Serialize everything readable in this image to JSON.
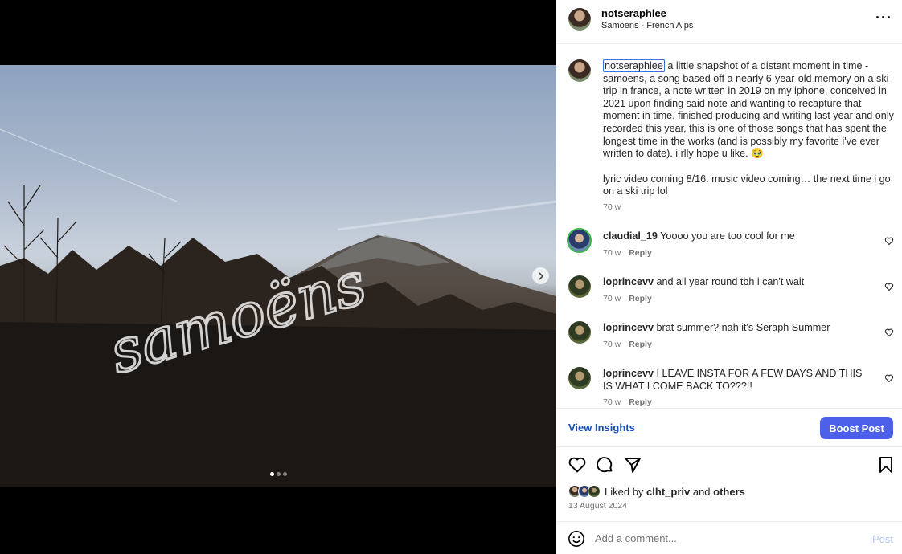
{
  "post": {
    "username": "notseraphlee",
    "location": "Samoens - French Alps",
    "caption": {
      "tag": "notseraphlee",
      "text": " a little snapshot of a distant moment in time - samoëns, a song based off a nearly 6-year-old memory on a ski trip in france, a note written in 2019 on my iphone, conceived in 2021 upon finding said note and wanting to recapture that moment in time, finished producing and writing last year and only recorded this year, this is one of those songs that has spent the longest time in the works (and is possibly my favorite i've ever written to date). i rlly hope u like. 🥹",
      "text2": "lyric video coming 8/16. music video coming… the next time i go on a ski trip lol",
      "age": "70 w"
    },
    "image": {
      "overlay_text": "samoëns",
      "slide_count": 3,
      "active_slide": 1
    }
  },
  "comments": [
    {
      "user": "claudial_19",
      "text": " Yoooo you are too cool for me",
      "age": "70 w",
      "reply": "Reply"
    },
    {
      "user": "loprincevv",
      "text": " and all year round tbh i can't wait",
      "age": "70 w",
      "reply": "Reply"
    },
    {
      "user": "loprincevv",
      "text": " brat summer? nah it's Seraph Summer",
      "age": "70 w",
      "reply": "Reply"
    },
    {
      "user": "loprincevv",
      "text": " I LEAVE INSTA FOR A FEW DAYS AND THIS IS WHAT I COME BACK TO???!!",
      "age": "70 w",
      "reply": "Reply"
    }
  ],
  "insights": {
    "view_label": "View Insights",
    "boost_label": "Boost Post"
  },
  "likes": {
    "prefix": "Liked by ",
    "user": "clht_priv",
    "mid": " and ",
    "others": "others"
  },
  "date": "13 August 2024",
  "add_comment": {
    "placeholder": "Add a comment...",
    "post_label": "Post"
  },
  "colors": {
    "accent": "#4b5fe8",
    "link": "#1a4fb8",
    "post_disabled": "#b3c7f5"
  },
  "icons": [
    "more-options-icon",
    "heart-icon",
    "comment-icon",
    "share-icon",
    "bookmark-icon",
    "emoji-icon",
    "chevron-right-icon"
  ]
}
